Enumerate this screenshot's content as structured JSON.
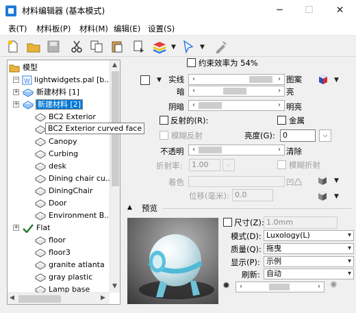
{
  "window": {
    "title": "材料编辑器 (基本模式)",
    "minimize": "─",
    "maximize": "☐",
    "close": "✕"
  },
  "menu": [
    "表(T)",
    "材料板(P)",
    "材料(M)",
    "编辑(E)",
    "设置(S)"
  ],
  "tree": {
    "root": "模型",
    "palette": "lightwidgets.pal [b...",
    "items": [
      {
        "label": "新建材料 [1]",
        "expandable": true,
        "selected": false
      },
      {
        "label": "新建材料 [2]",
        "expandable": true,
        "selected": true
      },
      {
        "label": "BC2 Exterior"
      },
      {
        "label": "BC2 Exterior curved face"
      },
      {
        "label": "Canopy"
      },
      {
        "label": "Curbing"
      },
      {
        "label": "desk"
      },
      {
        "label": "Dining chair cu..."
      },
      {
        "label": "DiningChair"
      },
      {
        "label": "Door"
      },
      {
        "label": "Environment B..."
      },
      {
        "label": "Flat",
        "expandable": true,
        "flat": true
      },
      {
        "label": "floor"
      },
      {
        "label": "floor3"
      },
      {
        "label": "granite atlanta"
      },
      {
        "label": "gray plastic"
      },
      {
        "label": "Lamp base"
      }
    ],
    "tooltip": "BC2 Exterior curved face"
  },
  "props": {
    "constraint_label": "约束效率为 54%",
    "solid": "实线",
    "pattern": "图案",
    "dark": "暗",
    "bright": "亮",
    "shade": "阴暗",
    "shiny": "明亮",
    "reflect": "反射的(R):",
    "metal": "金属",
    "blur_reflect": "模糊反射",
    "brightness_label": "亮度(G):",
    "brightness_value": "0",
    "opacity": "不透明",
    "clear": "清除",
    "refraction_label": "折射率:",
    "refraction_value": "1.00",
    "blur_refract": "模糊折射",
    "color_label": "着色",
    "bump_label": "凹凸",
    "offset_label": "位移(毫米):",
    "offset_value": "0.0"
  },
  "preview": {
    "header": "预览",
    "size_label": "尺寸(Z):",
    "size_value": "1.0mm",
    "mode_label": "模式(D):",
    "mode_value": "Luxology(L)",
    "quality_label": "质量(Q):",
    "quality_value": "拖曳",
    "display_label": "显示(P):",
    "display_value": "示例",
    "refresh_label": "刷新:",
    "refresh_value": "自动"
  },
  "colors": {
    "selection": "#0078d7",
    "window_bg": "#f0f0f0",
    "accent": "#1e7bd6"
  }
}
